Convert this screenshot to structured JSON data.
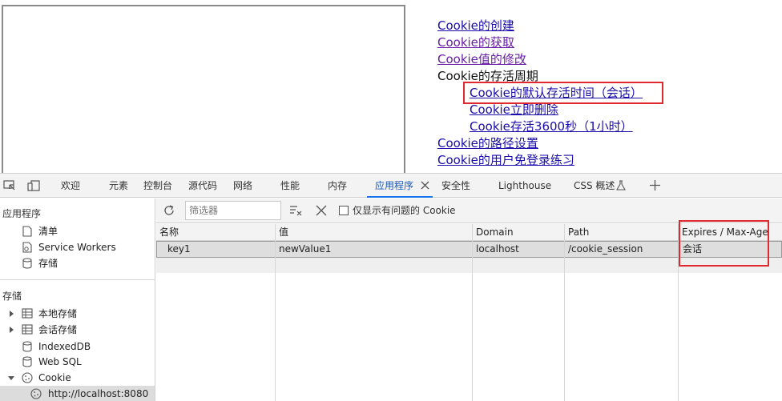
{
  "page": {
    "links": [
      {
        "label": "Cookie的创建"
      },
      {
        "label": "Cookie的获取"
      },
      {
        "label": "Cookie值的修改"
      },
      {
        "label": "Cookie的存活周期"
      },
      {
        "label": "Cookie的默认存活时间（会话）"
      },
      {
        "label": "Cookie立即删除"
      },
      {
        "label": "Cookie存活3600秒（1小时）"
      },
      {
        "label": "Cookie的路径设置"
      },
      {
        "label": "Cookie的用户免登录练习"
      }
    ]
  },
  "devtools": {
    "tabs": [
      "欢迎",
      "元素",
      "控制台",
      "源代码",
      "网络",
      "性能",
      "内存",
      "应用程序",
      "安全性",
      "Lighthouse",
      "CSS 概述"
    ],
    "active_tab": "应用程序",
    "sidebar": {
      "section_app": "应用程序",
      "app_items": [
        "清单",
        "Service Workers",
        "存储"
      ],
      "section_storage": "存储",
      "storage_items": [
        "本地存储",
        "会话存储",
        "IndexedDB",
        "Web SQL",
        "Cookie"
      ],
      "cookie_origin": "http://localhost:8080"
    },
    "toolbar": {
      "filter_placeholder": "筛选器",
      "only_issues_label": "仅显示有问题的 Cookie"
    },
    "table": {
      "columns": [
        "名称",
        "值",
        "Domain",
        "Path",
        "Expires / Max-Age"
      ],
      "rows": [
        {
          "name": "key1",
          "value": "newValue1",
          "domain": "localhost",
          "path": "/cookie_session",
          "expires": "会话"
        }
      ]
    }
  },
  "colors": {
    "link": "#1a0dab",
    "visited": "#681da8",
    "highlight": "#e0282f",
    "accent": "#1a73e8"
  }
}
